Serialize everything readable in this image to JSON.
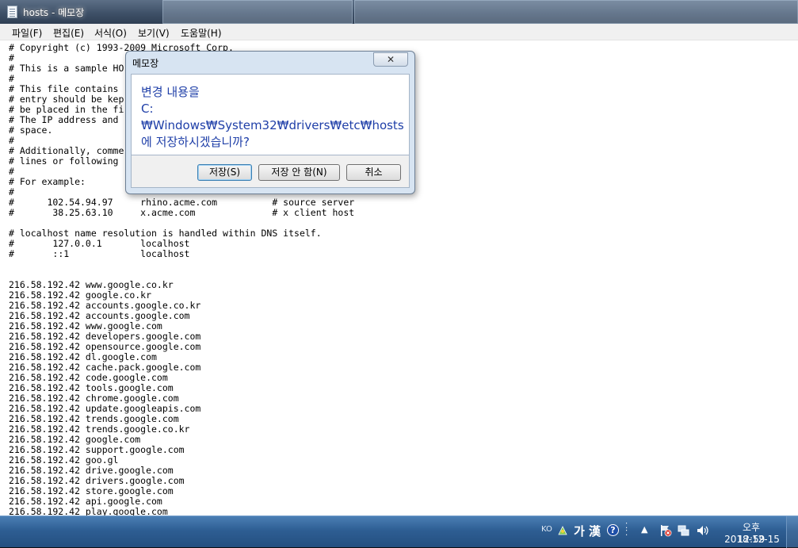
{
  "window": {
    "title": "hosts - 메모장"
  },
  "menu": [
    "파일(F)",
    "편집(E)",
    "서식(O)",
    "보기(V)",
    "도움말(H)"
  ],
  "editor": {
    "lines": [
      "# Copyright (c) 1993-2009 Microsoft Corp.",
      "#",
      "# This is a sample HO",
      "#",
      "# This file contains",
      "# entry should be kep",
      "# be placed in the fi",
      "# The IP address and",
      "# space.",
      "#",
      "# Additionally, comme",
      "# lines or following",
      "#",
      "# For example:",
      "#",
      "#      102.54.94.97     rhino.acme.com          # source server",
      "#       38.25.63.10     x.acme.com              # x client host",
      "",
      "# localhost name resolution is handled within DNS itself.",
      "#\t127.0.0.1       localhost",
      "#\t::1             localhost",
      "",
      "",
      "216.58.192.42 www.google.co.kr",
      "216.58.192.42 google.co.kr",
      "216.58.192.42 accounts.google.co.kr",
      "216.58.192.42 accounts.google.com",
      "216.58.192.42 www.google.com",
      "216.58.192.42 developers.google.com",
      "216.58.192.42 opensource.google.com",
      "216.58.192.42 dl.google.com",
      "216.58.192.42 cache.pack.google.com",
      "216.58.192.42 code.google.com",
      "216.58.192.42 tools.google.com",
      "216.58.192.42 chrome.google.com",
      "216.58.192.42 update.googleapis.com",
      "216.58.192.42 trends.google.com",
      "216.58.192.42 trends.google.co.kr",
      "216.58.192.42 google.com",
      "216.58.192.42 support.google.com",
      "216.58.192.42 goo.gl",
      "216.58.192.42 drive.google.com",
      "216.58.192.42 drivers.google.com",
      "216.58.192.42 store.google.com",
      "216.58.192.42 api.google.com",
      "216.58.192.42 play.google.com"
    ]
  },
  "dialog": {
    "title": "메모장",
    "close_label": "✕",
    "message_line1": "변경 내용을",
    "message_line2": "C:₩Windows₩System32₩drivers₩etc₩hosts",
    "message_line3": "에 저장하시겠습니까?",
    "save_label": "저장(S)",
    "dont_save_label": "저장 안 함(N)",
    "cancel_label": "취소"
  },
  "taskbar": {
    "language": "KO",
    "ime_mode_1": "가",
    "ime_mode_2": "漢",
    "help_label": "?",
    "clock_time": "오후 12:59",
    "clock_date": "2018-12-15"
  },
  "colors": {
    "dialog_text": "#1f3fa8",
    "taskbar": "#2e5e93"
  }
}
